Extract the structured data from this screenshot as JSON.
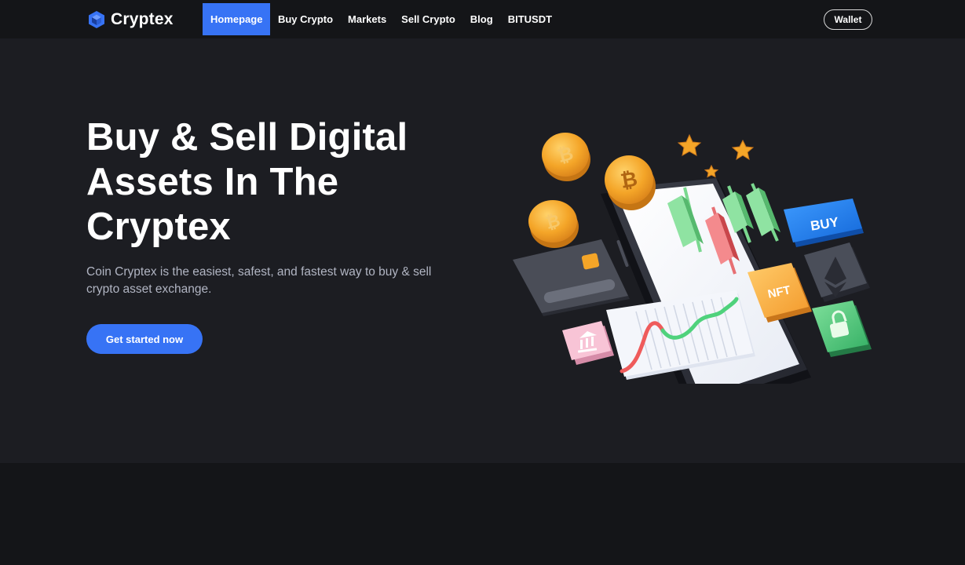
{
  "brand": {
    "name": "Cryptex",
    "logo_icon": "cube-hexagon-icon",
    "accent_color": "#3773f5"
  },
  "nav": {
    "items": [
      {
        "label": "Homepage",
        "active": true
      },
      {
        "label": "Buy Crypto",
        "active": false
      },
      {
        "label": "Markets",
        "active": false
      },
      {
        "label": "Sell Crypto",
        "active": false
      },
      {
        "label": "Blog",
        "active": false
      },
      {
        "label": "BITUSDT",
        "active": false
      }
    ],
    "wallet_label": "Wallet"
  },
  "hero": {
    "title_line1": "Buy & Sell Digital",
    "title_line2": "Assets In The",
    "title_line3": "Cryptex",
    "description": "Coin Cryptex is the easiest, safest, and fastest way to buy & sell crypto asset exchange.",
    "cta_label": "Get started now",
    "illustration": {
      "buy_badge": "BUY",
      "nft_badge": "NFT",
      "icons": [
        "bitcoin-coin-icon",
        "star-icon",
        "credit-card-icon",
        "phone-icon",
        "candlestick-icon",
        "ethereum-icon",
        "lock-icon",
        "bank-icon",
        "line-chart-icon"
      ]
    }
  },
  "colors": {
    "page_bg": "#141518",
    "hero_bg": "#1c1d22",
    "muted_text": "#b1b5c3"
  }
}
